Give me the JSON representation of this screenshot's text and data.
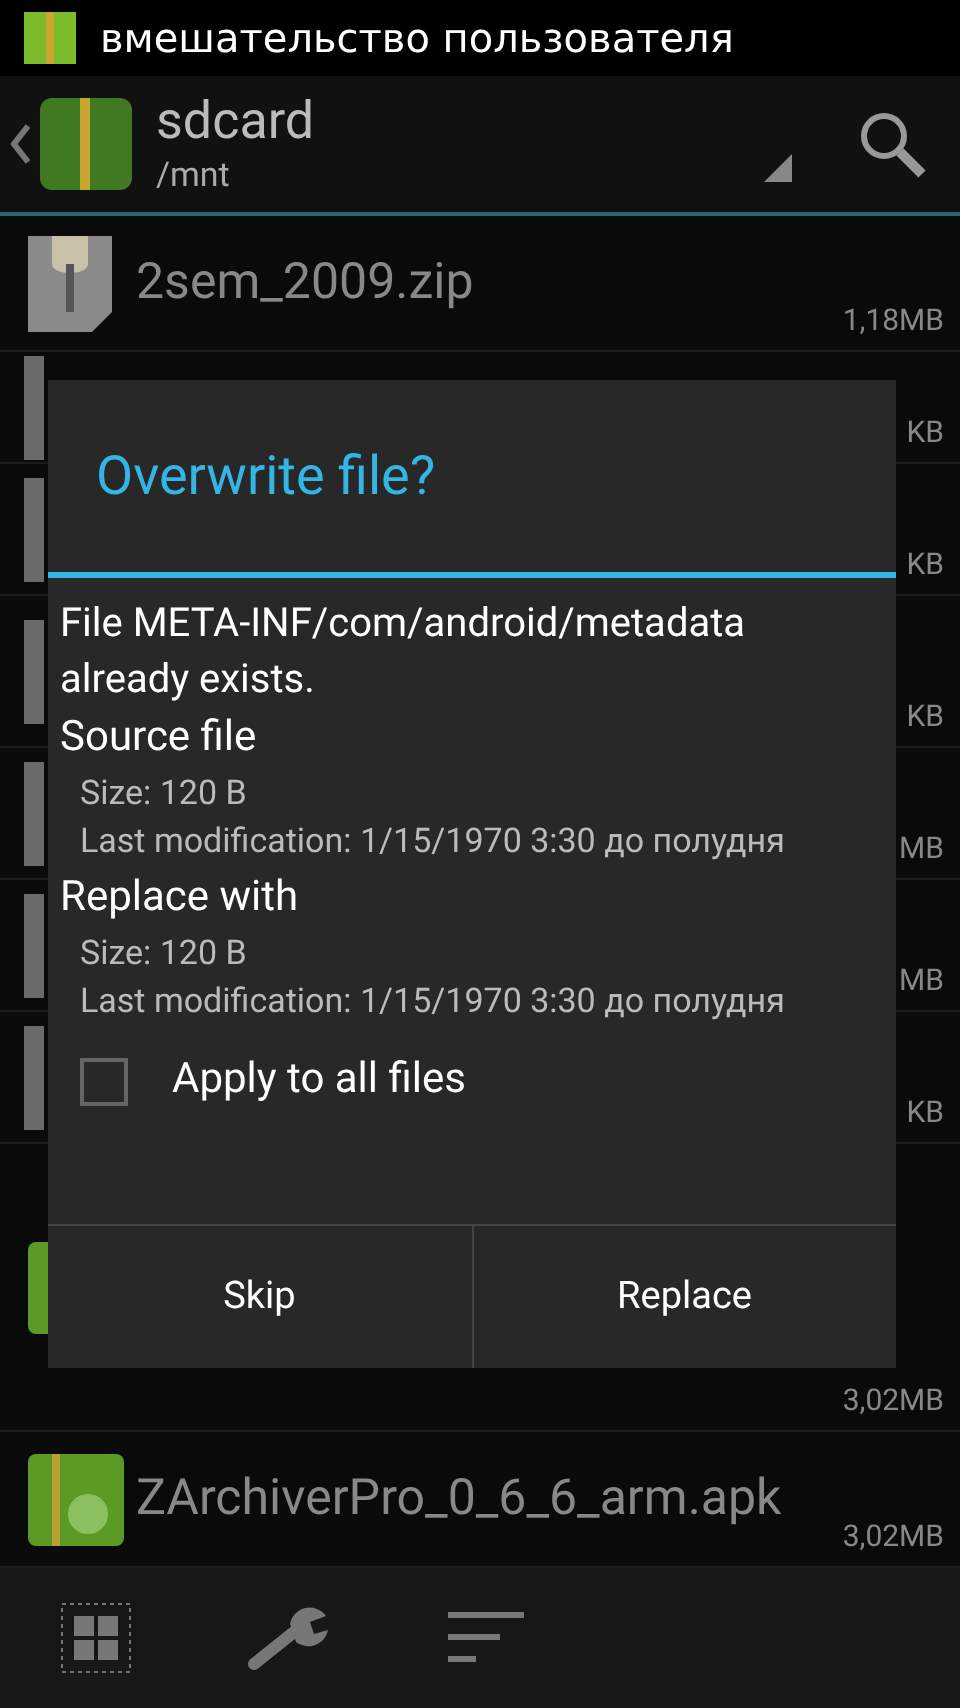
{
  "status_bar": {
    "title": "вмешательство пользователя"
  },
  "toolbar": {
    "title": "sdcard",
    "path": "/mnt"
  },
  "files": [
    {
      "kind": "zip",
      "name": "2sem_2009.zip",
      "size": "1,18MB"
    },
    {
      "kind": "file",
      "size": "KB"
    },
    {
      "kind": "file",
      "size": "KB"
    },
    {
      "kind": "file",
      "size": "KB"
    },
    {
      "kind": "file",
      "size": "MB"
    },
    {
      "kind": "file",
      "size": "MB"
    },
    {
      "kind": "file",
      "size": "KB"
    },
    {
      "kind": "apk",
      "size": "3,02MB"
    },
    {
      "kind": "apk",
      "name": "ZArchiverPro_0_6_6_arm.apk",
      "size": "3,02MB"
    }
  ],
  "dialog": {
    "title": "Overwrite file?",
    "message": "File META-INF/com/android/metadata already exists.",
    "sections": [
      {
        "heading": "Source file",
        "size": "Size: 120 B",
        "modified": "Last modification: 1/15/1970 3:30 до полудня"
      },
      {
        "heading": "Replace with",
        "size": "Size: 120 B",
        "modified": "Last modification: 1/15/1970 3:30 до полудня"
      }
    ],
    "apply_all": {
      "label": "Apply to all files",
      "checked": false
    },
    "buttons": [
      "Skip",
      "Replace"
    ]
  }
}
